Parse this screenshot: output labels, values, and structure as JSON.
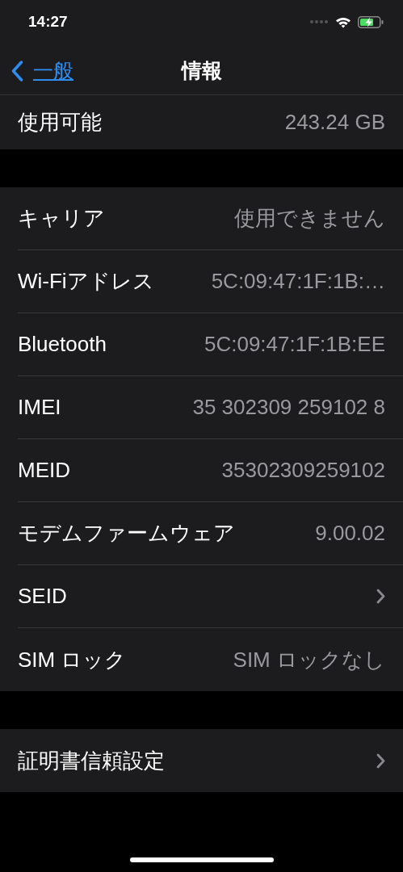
{
  "status_bar": {
    "time": "14:27"
  },
  "nav": {
    "back": "一般",
    "title": "情報"
  },
  "groups": [
    {
      "rows": [
        {
          "kind": "value",
          "label": "使用可能",
          "value": "243.24 GB"
        }
      ]
    },
    {
      "rows": [
        {
          "kind": "value",
          "label": "キャリア",
          "value": "使用できません"
        },
        {
          "kind": "value",
          "label": "Wi-Fiアドレス",
          "value": "5C:09:47:1F:1B:…"
        },
        {
          "kind": "value",
          "label": "Bluetooth",
          "value": "5C:09:47:1F:1B:EE"
        },
        {
          "kind": "value",
          "label": "IMEI",
          "value": "35 302309 259102 8"
        },
        {
          "kind": "value",
          "label": "MEID",
          "value": "35302309259102"
        },
        {
          "kind": "value",
          "label": "モデムファームウェア",
          "value": "9.00.02"
        },
        {
          "kind": "link",
          "label": "SEID"
        },
        {
          "kind": "value",
          "label": "SIM ロック",
          "value": "SIM ロックなし"
        }
      ]
    },
    {
      "rows": [
        {
          "kind": "link",
          "label": "証明書信頼設定"
        }
      ]
    }
  ]
}
